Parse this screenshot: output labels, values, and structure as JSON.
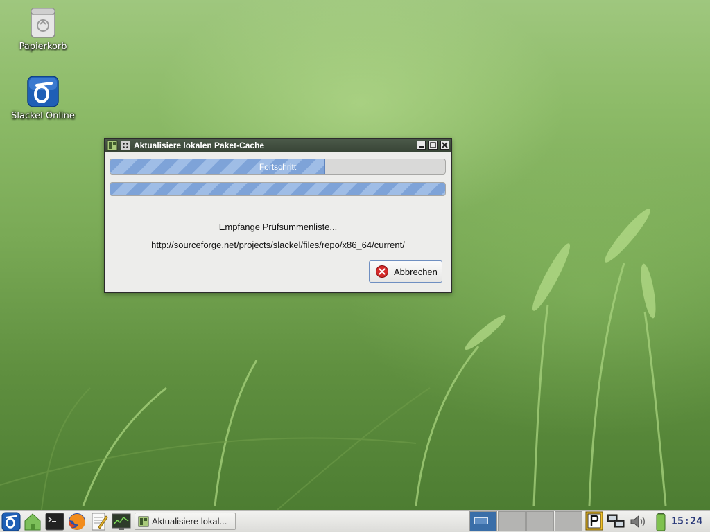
{
  "desktop": {
    "icons": [
      {
        "label": "Papierkorb",
        "icon": "trash-icon"
      },
      {
        "label": "Slackel Online",
        "icon": "slackel-logo-icon"
      }
    ]
  },
  "dialog": {
    "title": "Aktualisiere lokalen Paket-Cache",
    "progress_main": {
      "label": "Fortschritt",
      "fraction": 0.64
    },
    "progress_secondary": {
      "fraction": 1.0
    },
    "status_line": "Empfange Prüfsummenliste...",
    "url_line": "http://sourceforge.net/projects/slackel/files/repo/x86_64/current/",
    "cancel_label_prefix": "A",
    "cancel_label_rest": "bbrechen"
  },
  "taskbar": {
    "task_button_label": "Aktualisiere lokal...",
    "clock": "15:24",
    "colors": {
      "accent": "#2b5fa4",
      "active_workspace": "#3a6ea8"
    }
  }
}
